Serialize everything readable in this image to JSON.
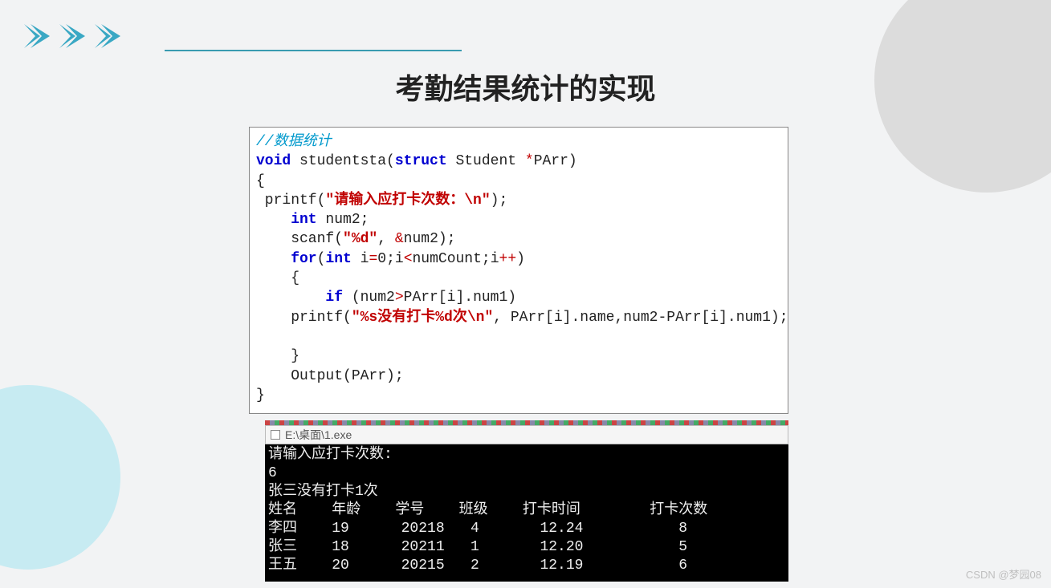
{
  "title": "考勤结果统计的实现",
  "code": {
    "comment": "//数据统计",
    "l1a": "void",
    "l1b": " studentsta(",
    "l1c": "struct",
    "l1d": " Student ",
    "l1e": "*",
    "l1f": "PArr)",
    "l2": "{",
    "l3a": " printf(",
    "l3b": "\"请输入应打卡次数：\\n\"",
    "l3c": ");",
    "l4a": "    int",
    "l4b": " num2;",
    "l5a": "    scanf(",
    "l5b": "\"%d\"",
    "l5c": ", ",
    "l5d": "&",
    "l5e": "num2);",
    "l6a": "    for",
    "l6b": "(",
    "l6c": "int",
    "l6d": " i",
    "l6e": "=",
    "l6f": "0",
    "l6g": ";i",
    "l6h": "<",
    "l6i": "numCount;i",
    "l6j": "++",
    "l6k": ")",
    "l7": "    {",
    "l8a": "        if",
    "l8b": " (num2",
    "l8c": ">",
    "l8d": "PArr[i].num1)",
    "l9a": "    printf(",
    "l9b": "\"%s没有打卡%d次\\n\"",
    "l9c": ", PArr[i].name,num2-PArr[i].num1);",
    "l10": "",
    "l11": "    }",
    "l12": "    Output(PArr);",
    "l13": "}"
  },
  "console": {
    "title": "E:\\桌面\\1.exe",
    "lines": {
      "prompt": "请输入应打卡次数:",
      "input": "6",
      "msg": "张三没有打卡1次",
      "h": "姓名    年龄    学号    班级    打卡时间        打卡次数",
      "r1": "李四    19      20218   4       12.24           8",
      "r2": "张三    18      20211   1       12.20           5",
      "r3": "王五    20      20215   2       12.19           6"
    }
  },
  "watermark": "CSDN @梦园08"
}
